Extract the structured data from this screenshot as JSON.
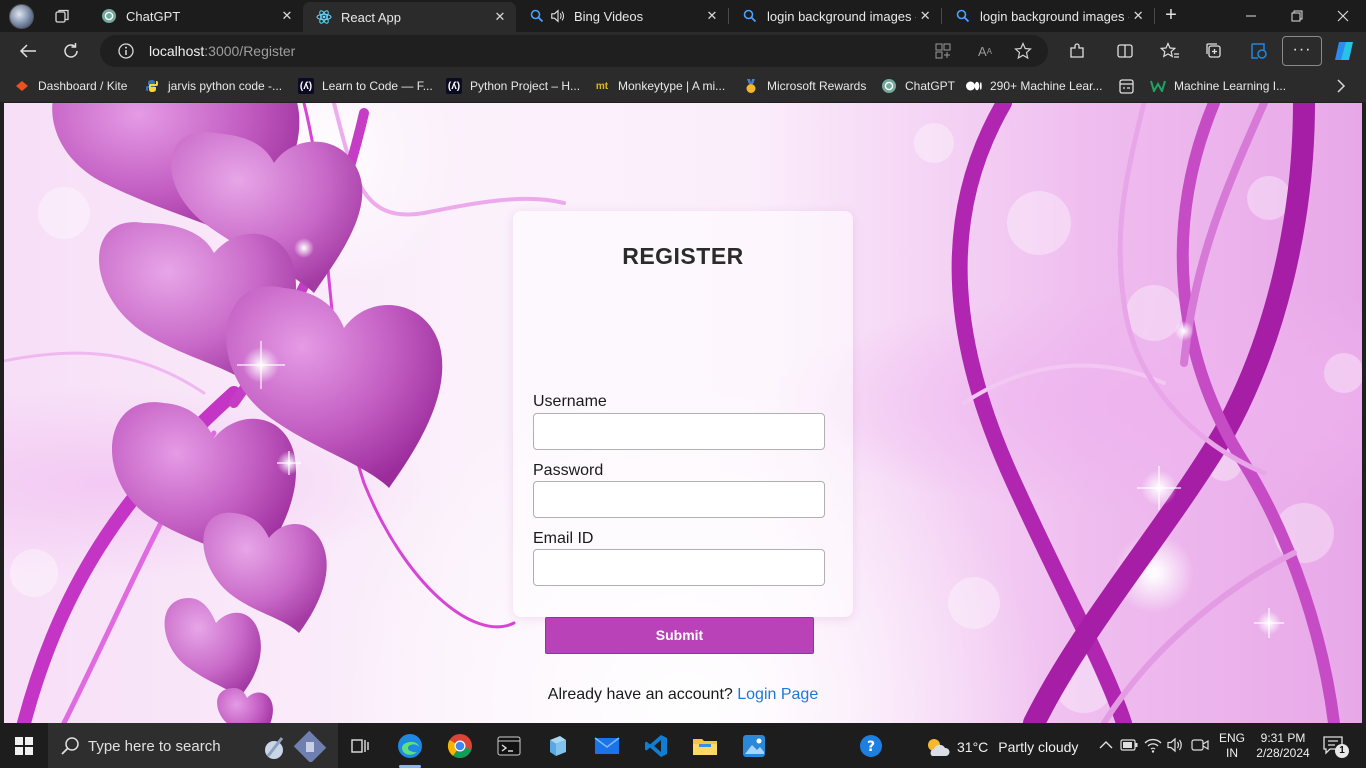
{
  "browser": {
    "tabs": [
      {
        "label": "ChatGPT",
        "icon": "chatgpt-icon",
        "active": false
      },
      {
        "label": "React App",
        "icon": "react-icon",
        "active": true
      },
      {
        "label": "Bing Videos",
        "icon": "search-icon",
        "active": false
      },
      {
        "label": "login background images - ",
        "icon": "search-icon",
        "active": false
      },
      {
        "label": "login background images - ",
        "icon": "search-icon",
        "active": false
      }
    ],
    "address": {
      "host": "localhost",
      "path": ":3000/Register"
    },
    "favorites": [
      {
        "label": "Dashboard / Kite",
        "icon": "kite-icon"
      },
      {
        "label": "jarvis python code -...",
        "icon": "python-icon"
      },
      {
        "label": "Learn to Code — F...",
        "icon": "freecodecamp-icon"
      },
      {
        "label": "Python Project – H...",
        "icon": "freecodecamp-icon"
      },
      {
        "label": "Monkeytype | A mi...",
        "icon": "monkeytype-icon",
        "icon_text": "mt"
      },
      {
        "label": "Microsoft Rewards",
        "icon": "rewards-medal-icon"
      },
      {
        "label": "ChatGPT",
        "icon": "chatgpt-icon"
      },
      {
        "label": "290+ Machine Lear...",
        "icon": "medium-icon"
      },
      {
        "label": "",
        "icon": "app-icon"
      },
      {
        "label": "Machine Learning I...",
        "icon": "ml-icon"
      }
    ]
  },
  "form": {
    "title": "REGISTER",
    "username_label": "Username",
    "username_value": "",
    "password_label": "Password",
    "password_value": "",
    "email_label": "Email ID",
    "email_value": "",
    "submit_label": "Submit",
    "footer_text": "Already have an account?",
    "login_link": "Login Page"
  },
  "taskbar": {
    "search_placeholder": "Type here to search",
    "weather_temp": "31°C",
    "weather_desc": "Partly cloudy",
    "lang_line1": "ENG",
    "lang_line2": "IN",
    "time": "9:31 PM",
    "date": "2/28/2024",
    "notification_count": "1"
  },
  "colors": {
    "accent": "#b942b9",
    "link": "#1e78d7",
    "edge_blue": "#1e88e5"
  }
}
